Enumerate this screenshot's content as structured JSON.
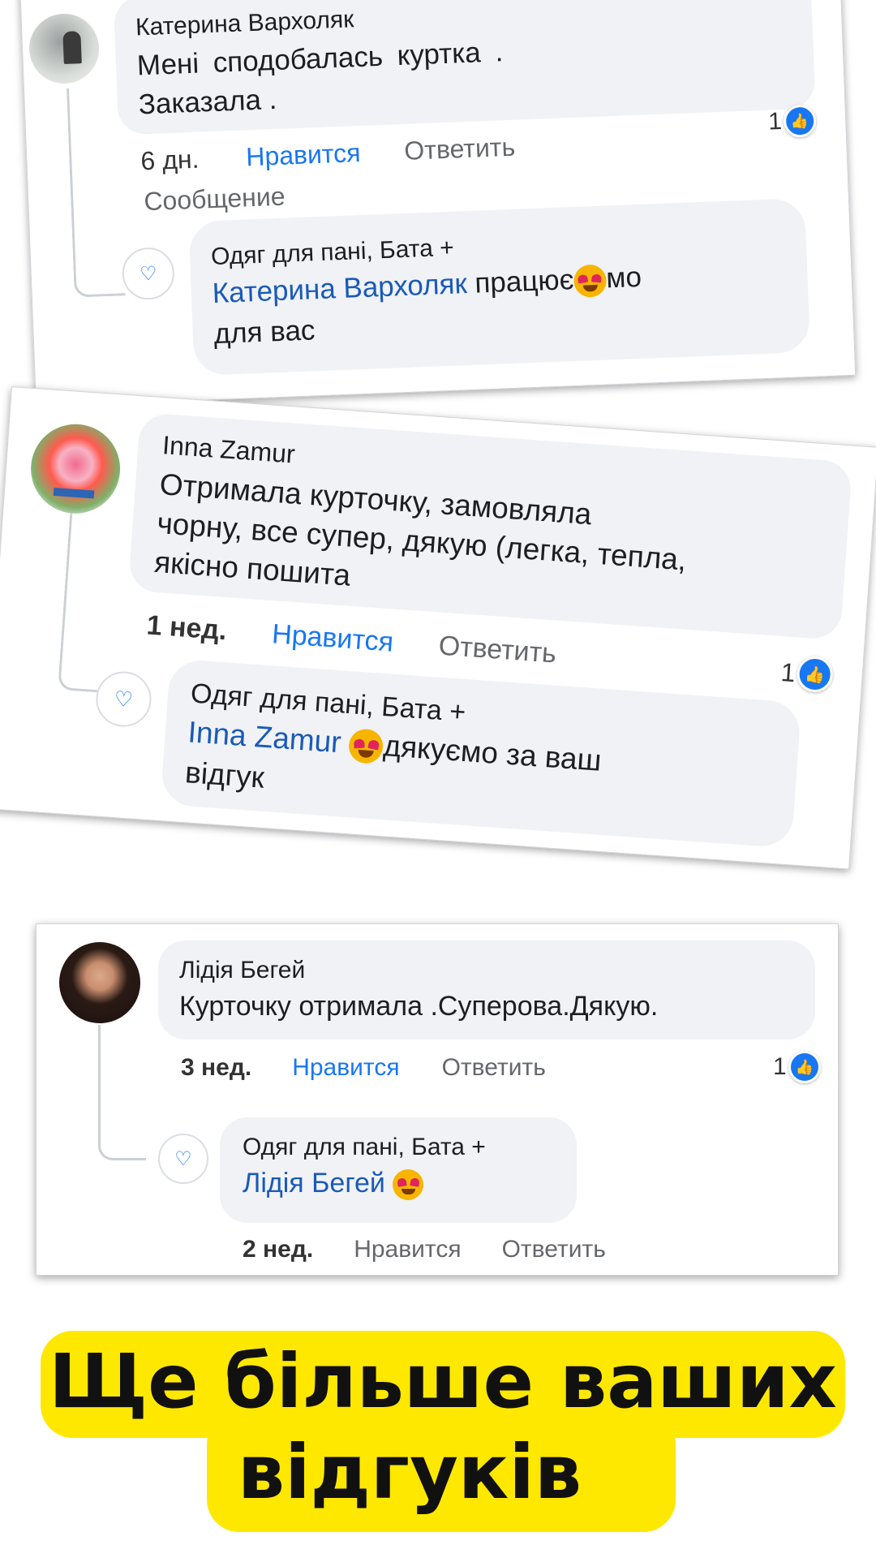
{
  "comments": [
    {
      "author": "Катерина Вархоляк",
      "text_line1": "Мені сподобалась куртка .",
      "text_line2": "Заказала .",
      "time": "6 дн.",
      "like_label": "Нравится",
      "reply_label": "Ответить",
      "message_label": "Сообщение",
      "reaction_count": "1",
      "reply": {
        "author": "Одяг для пані, Бата +",
        "mention": "Катерина Вархоляк",
        "text_a": "працює",
        "text_b": "мо",
        "text_c": "для вас"
      }
    },
    {
      "author": "Inna Zamur",
      "text_line1": "Отримала курточку, замовляла",
      "text_line2": "чорну, все супер, дякую (легка, тепла,",
      "text_line3": "якісно пошита",
      "time": "1 нед.",
      "like_label": "Нравится",
      "reply_label": "Ответить",
      "reaction_count": "1",
      "reply": {
        "author": "Одяг для пані, Бата +",
        "mention": "Inna Zamur",
        "text_a": "дякуємо за ваш",
        "text_c": "відгук"
      }
    },
    {
      "author": "Лідія Бегей",
      "text_line1": "Курточку отримала .Суперова.Дякую.",
      "time": "3 нед.",
      "like_label": "Нравится",
      "reply_label": "Ответить",
      "reaction_count": "1",
      "reply": {
        "author": "Одяг для пані, Бата +",
        "mention": "Лідія Бегей",
        "time": "2 нед.",
        "like_label": "Нравится",
        "reply_label": "Ответить"
      }
    }
  ],
  "banner": {
    "line1": "Ще більше ваших",
    "line2": "відгуків"
  },
  "colors": {
    "like_blue": "#1877f2",
    "bubble_gray": "#f0f2f5",
    "banner_yellow": "#ffe800"
  },
  "icons": [
    "like-reaction-icon",
    "heart-eyes-emoji-icon",
    "avatar"
  ]
}
